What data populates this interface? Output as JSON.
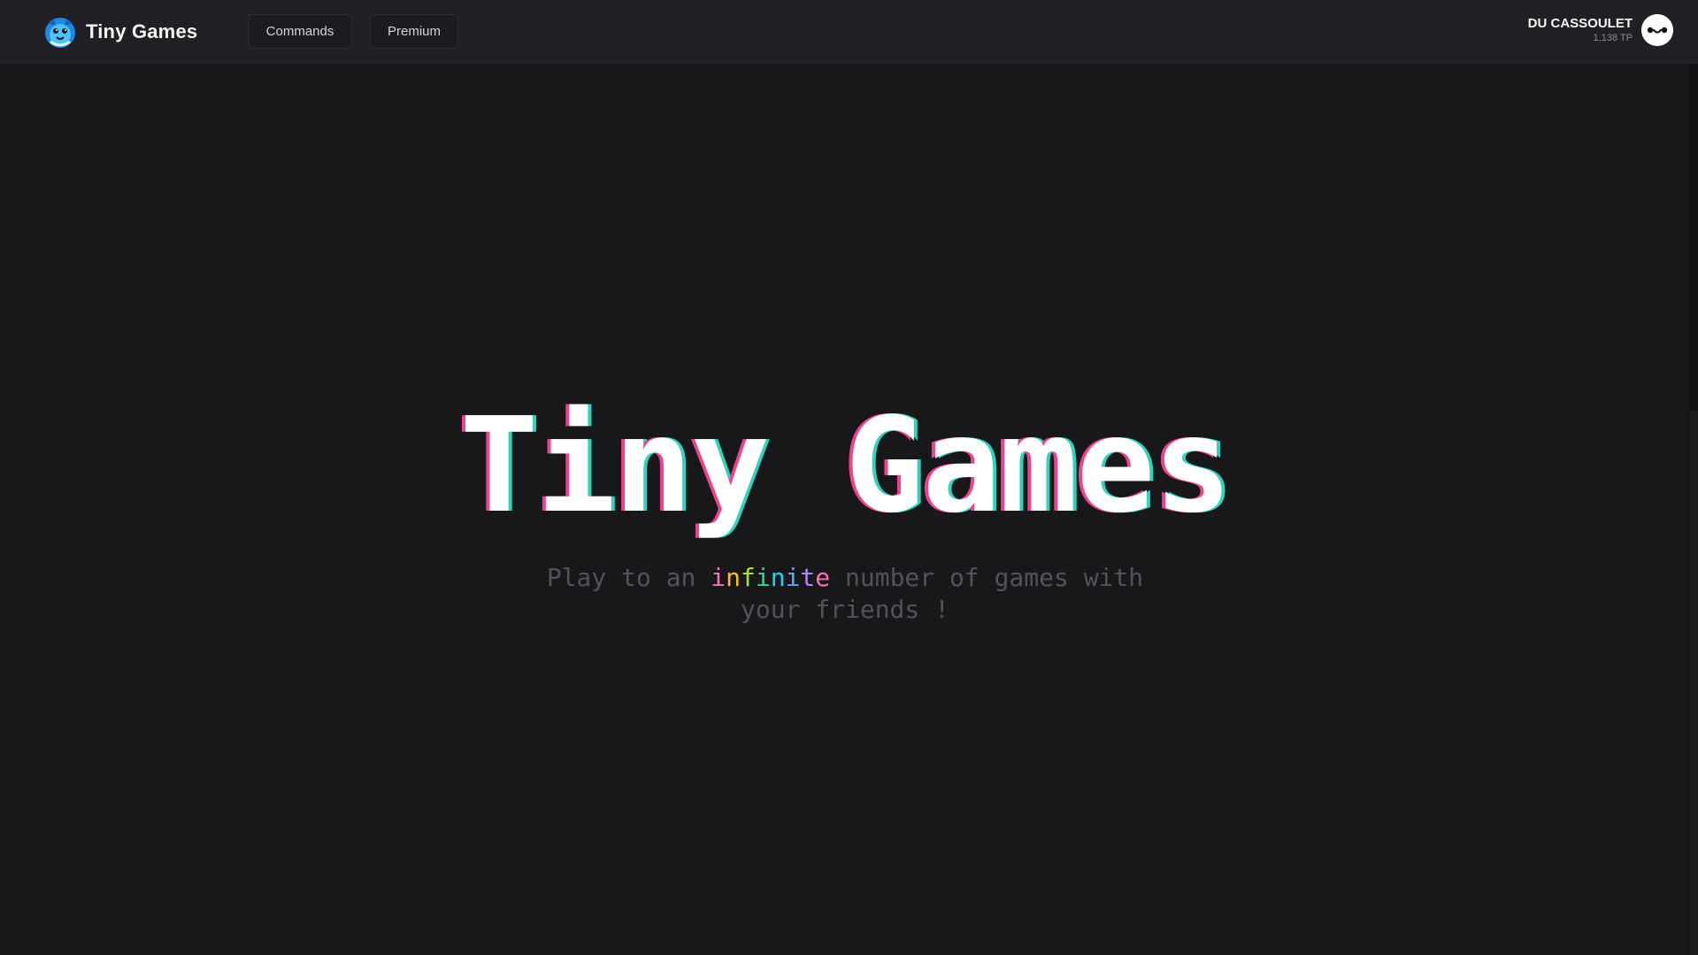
{
  "header": {
    "brand_name": "Tiny Games",
    "nav": {
      "commands": "Commands",
      "premium": "Premium"
    },
    "user": {
      "name": "DU CASSOULET",
      "points": "1,138 TP"
    }
  },
  "hero": {
    "title": "Tiny Games",
    "subtitle_before": "Play to an ",
    "subtitle_highlight": "infinite",
    "subtitle_after": " number of games with your friends !",
    "highlight_colors": [
      "#f472b6",
      "#fbbf24",
      "#a3e635",
      "#34d399",
      "#22d3ee",
      "#60a5fa",
      "#a78bfa",
      "#f472b6"
    ]
  },
  "icons": {
    "brand_logo": "blue-creature-logo-icon",
    "avatar": "white-face-avatar-icon"
  },
  "colors": {
    "background": "#18181b",
    "header": "#202024",
    "title_shadow_left": "#f43f8e",
    "title_shadow_right": "#2dd4bf"
  }
}
